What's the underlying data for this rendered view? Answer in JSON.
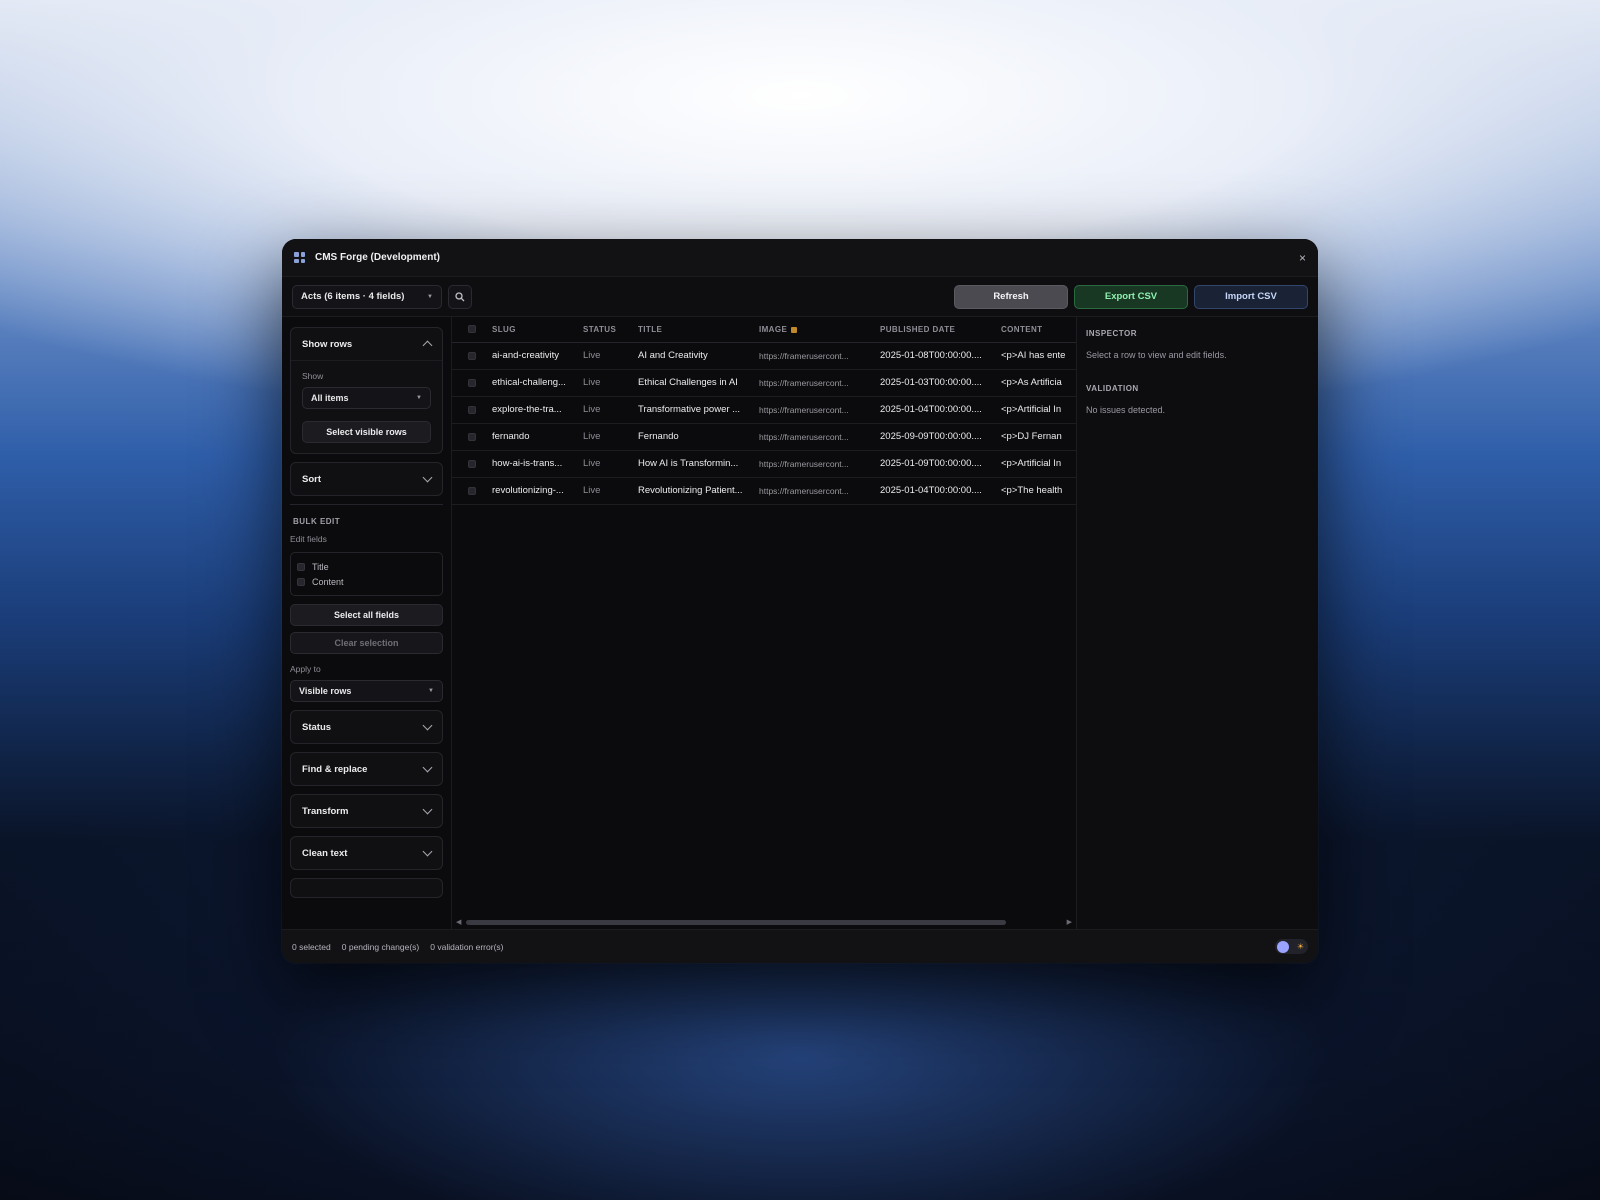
{
  "window": {
    "title": "CMS Forge (Development)",
    "close_glyph": "×"
  },
  "toolbar": {
    "collection": "Acts (6 items · 4 fields)",
    "refresh": "Refresh",
    "export": "Export CSV",
    "import": "Import CSV"
  },
  "sidebar": {
    "show_rows": {
      "heading": "Show rows",
      "show_label": "Show",
      "show_value": "All items",
      "select_visible": "Select visible rows"
    },
    "sort": {
      "heading": "Sort"
    },
    "bulk_edit": {
      "heading": "BULK EDIT",
      "edit_fields_label": "Edit fields",
      "fields": [
        "Title",
        "Content"
      ],
      "select_all": "Select all fields",
      "clear": "Clear selection",
      "apply_to_label": "Apply to",
      "apply_to_value": "Visible rows"
    },
    "panels": [
      "Status",
      "Find & replace",
      "Transform",
      "Clean text"
    ]
  },
  "table": {
    "columns": [
      "SLUG",
      "STATUS",
      "TITLE",
      "IMAGE",
      "PUBLISHED DATE",
      "CONTENT"
    ],
    "rows": [
      {
        "slug": "ai-and-creativity",
        "status": "Live",
        "title": "AI and Creativity",
        "image": "https://framerusercont...",
        "date": "2025-01-08T00:00:00....",
        "content": "<p>AI has ente"
      },
      {
        "slug": "ethical-challeng...",
        "status": "Live",
        "title": "Ethical Challenges in AI",
        "image": "https://framerusercont...",
        "date": "2025-01-03T00:00:00....",
        "content": "<p>As Artificia"
      },
      {
        "slug": "explore-the-tra...",
        "status": "Live",
        "title": "Transformative power ...",
        "image": "https://framerusercont...",
        "date": "2025-01-04T00:00:00....",
        "content": "<p>Artificial In"
      },
      {
        "slug": "fernando",
        "status": "Live",
        "title": "Fernando",
        "image": "https://framerusercont...",
        "date": "2025-09-09T00:00:00....",
        "content": "<p>DJ Fernan"
      },
      {
        "slug": "how-ai-is-trans...",
        "status": "Live",
        "title": "How AI is Transformin...",
        "image": "https://framerusercont...",
        "date": "2025-01-09T00:00:00....",
        "content": "<p>Artificial In"
      },
      {
        "slug": "revolutionizing-...",
        "status": "Live",
        "title": "Revolutionizing Patient...",
        "image": "https://framerusercont...",
        "date": "2025-01-04T00:00:00....",
        "content": "<p>The health"
      }
    ]
  },
  "inspector": {
    "heading": "INSPECTOR",
    "hint": "Select a row to view and edit fields.",
    "validation_heading": "VALIDATION",
    "validation_text": "No issues detected."
  },
  "statusbar": {
    "selected": "0 selected",
    "pending": "0 pending change(s)",
    "errors": "0 validation error(s)"
  },
  "colors": {
    "accent_green": "#8ff0b0",
    "accent_blue": "#c6d6f6",
    "lock": "#c08a2a"
  }
}
